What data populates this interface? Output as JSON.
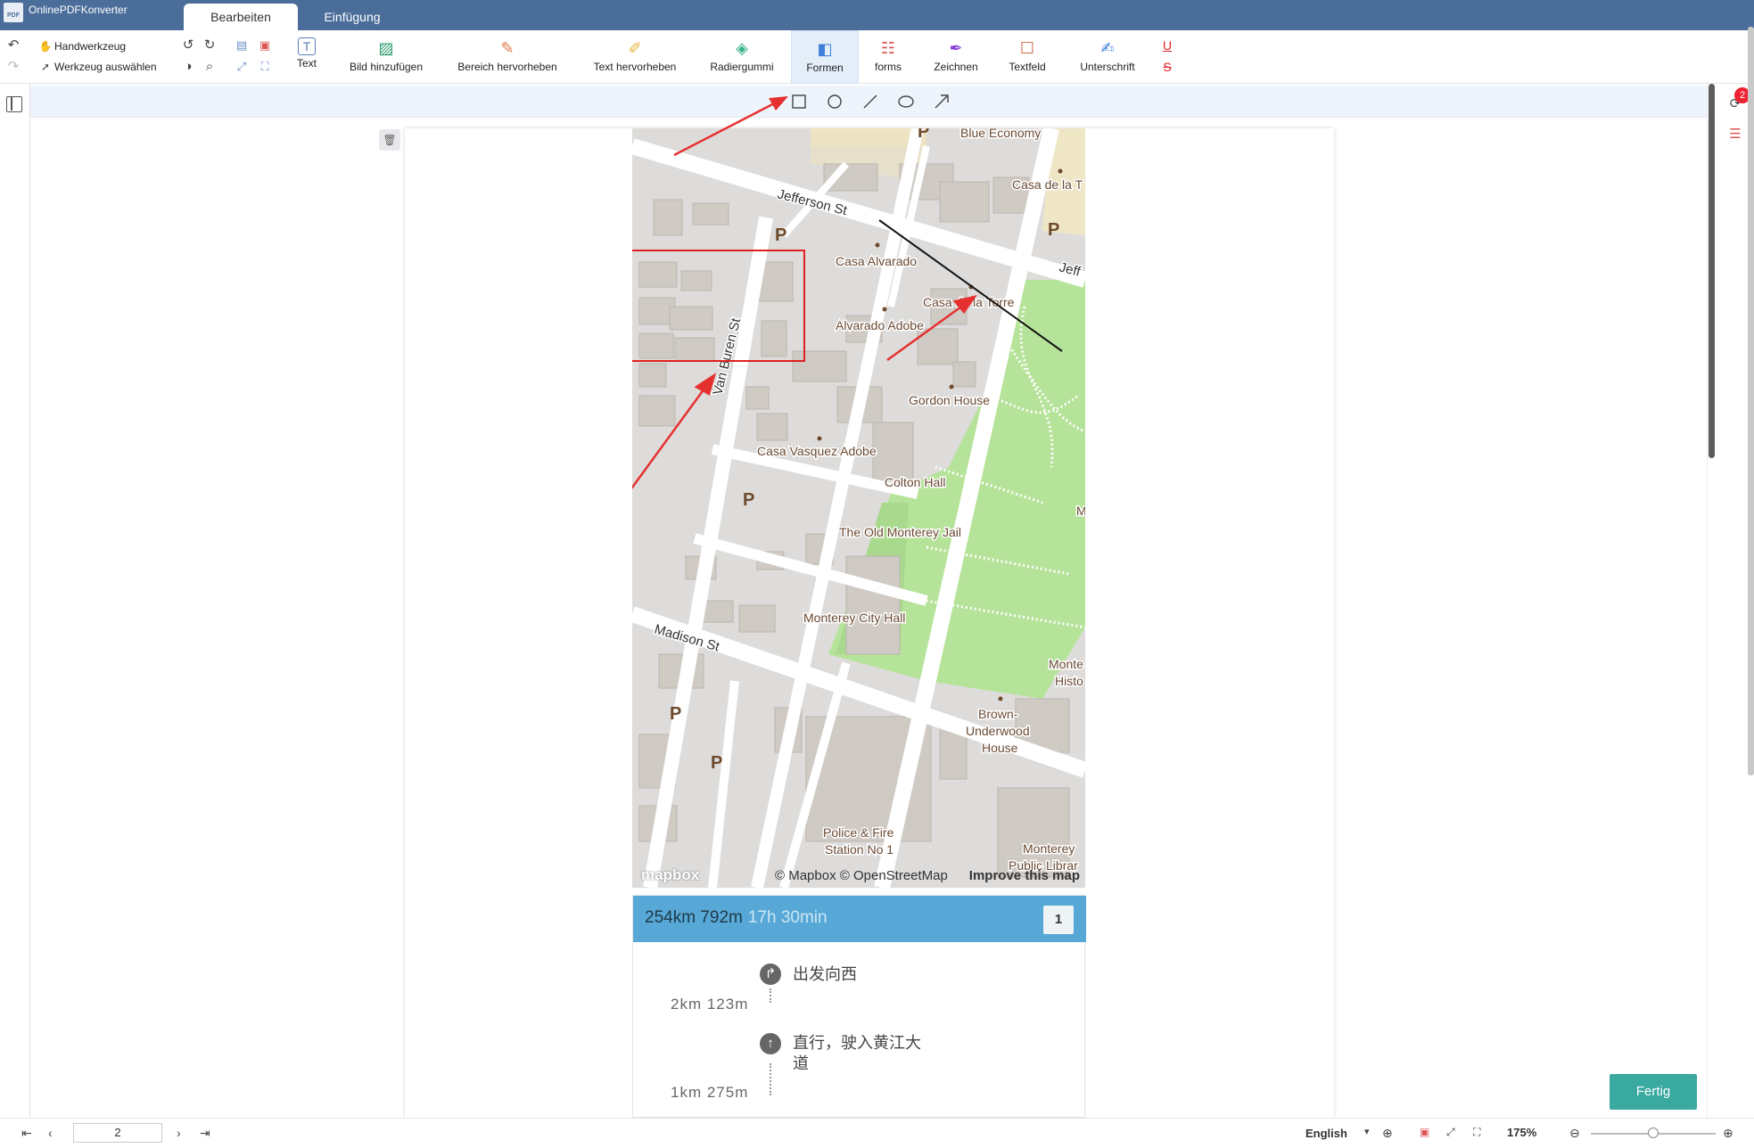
{
  "app": {
    "title": "OnlinePDFKonverter",
    "logo_text": "PDF",
    "tabs": [
      {
        "label": "Bearbeiten"
      },
      {
        "label": "Einfügung"
      }
    ]
  },
  "toolbar": {
    "hand_tool": "Handwerkzeug",
    "select_tool": "Werkzeug auswählen",
    "tools": [
      {
        "label": "Text"
      },
      {
        "label": "Bild hinzufügen"
      },
      {
        "label": "Bereich hervorheben"
      },
      {
        "label": "Text hervorheben"
      },
      {
        "label": "Radiergummi"
      },
      {
        "label": "Formen"
      },
      {
        "label": "forms"
      },
      {
        "label": "Zeichnen"
      },
      {
        "label": "Textfeld"
      },
      {
        "label": "Unterschrift"
      }
    ],
    "active_tool": "Formen",
    "accent": "#4a6d9a"
  },
  "sidebar_right": {
    "comment_badge": "2"
  },
  "map": {
    "labels": {
      "blue_economy": "Blue Economy",
      "casa_tr": "Casa de la T",
      "jefferson": "Jefferson St",
      "jeff_right": "Jeff",
      "casa_alvarado": "Casa Alvarado",
      "casa_torre": "Casa de la Torre",
      "alvarado_adobe": "Alvarado Adobe",
      "van_buren": "Van Buren St",
      "gordon_house": "Gordon House",
      "casa_vasquez": "Casa Vasquez Adobe",
      "colton_hall": "Colton Hall",
      "old_jail": "The Old Monterey Jail",
      "city_hall": "Monterey City Hall",
      "madison": "Madison St",
      "monte_histo_1": "Monte",
      "monte_histo_2": "Histo",
      "brown_1": "Brown-",
      "brown_2": "Underwood",
      "brown_3": "House",
      "police_1": "Police & Fire",
      "police_2": "Station No 1",
      "library_1": "Monterey",
      "library_2": "Public Librar",
      "parking": "P",
      "m_edge": "M"
    },
    "attribution": {
      "logo": "mapbox",
      "text": "© Mapbox © OpenStreetMap",
      "improve": "Improve this map"
    }
  },
  "route": {
    "distance": "254km 792m",
    "duration": "17h 30min",
    "step_number": "1",
    "steps": [
      {
        "text": "出发向西",
        "distance": "2km 123m"
      },
      {
        "text_line1": "直行，驶入黄江大",
        "text_line2": "道",
        "distance": "1km 275m"
      }
    ]
  },
  "buttons": {
    "done": "Fertig"
  },
  "status": {
    "page_number": "2",
    "language": "English",
    "zoom": "175%"
  }
}
